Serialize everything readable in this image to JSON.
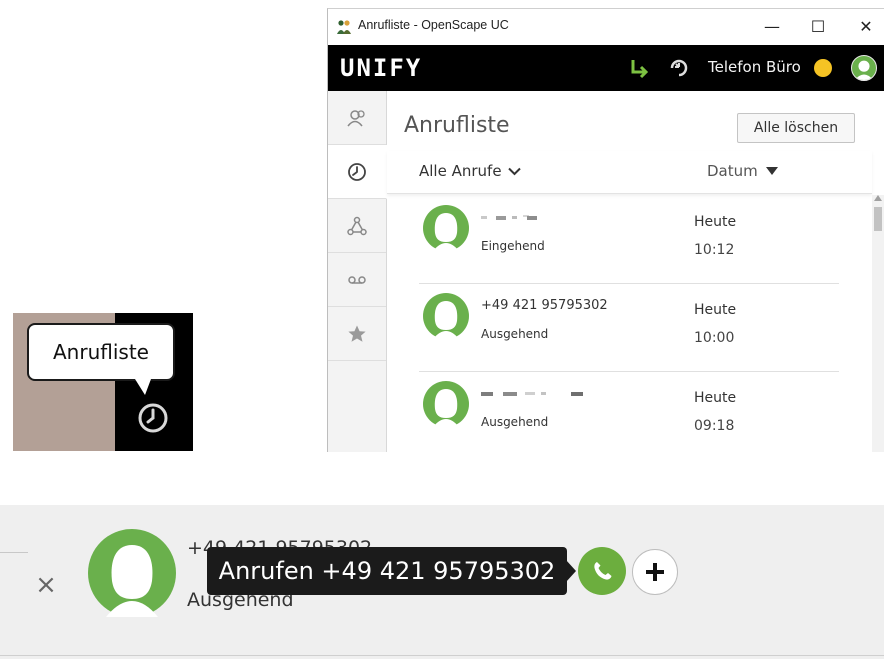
{
  "tooltip_crop": {
    "label": "Anrufliste"
  },
  "window": {
    "title": "Anrufliste - OpenScape UC",
    "controls": {
      "minimize": "—",
      "maximize": "☐",
      "close": "✕"
    }
  },
  "brand": {
    "logo": "UNIFY",
    "device": "Telefon Büro",
    "presence_color": "#f5c324"
  },
  "sidebar": {
    "items": [
      {
        "name": "contacts-icon"
      },
      {
        "name": "call-history-icon",
        "active": true
      },
      {
        "name": "network-icon"
      },
      {
        "name": "voicemail-icon"
      },
      {
        "name": "favorites-icon"
      }
    ]
  },
  "main": {
    "title": "Anrufliste",
    "clear_all": "Alle löschen",
    "filter": "Alle Anrufe",
    "sort": "Datum",
    "calls": [
      {
        "name": "",
        "direction": "Eingehend",
        "day": "Heute",
        "time": "10:12"
      },
      {
        "name": "+49 421 95795302",
        "direction": "Ausgehend",
        "day": "Heute",
        "time": "10:00"
      },
      {
        "name": "",
        "direction": "Ausgehend",
        "day": "Heute",
        "time": "09:18"
      }
    ]
  },
  "contact_row": {
    "number": "+49 421 95795302",
    "direction": "Ausgehend",
    "call_tooltip": "Anrufen +49 421 95795302"
  },
  "colors": {
    "accent_green": "#6cae3e",
    "brand_black": "#000000",
    "presence_yellow": "#f5c324"
  }
}
